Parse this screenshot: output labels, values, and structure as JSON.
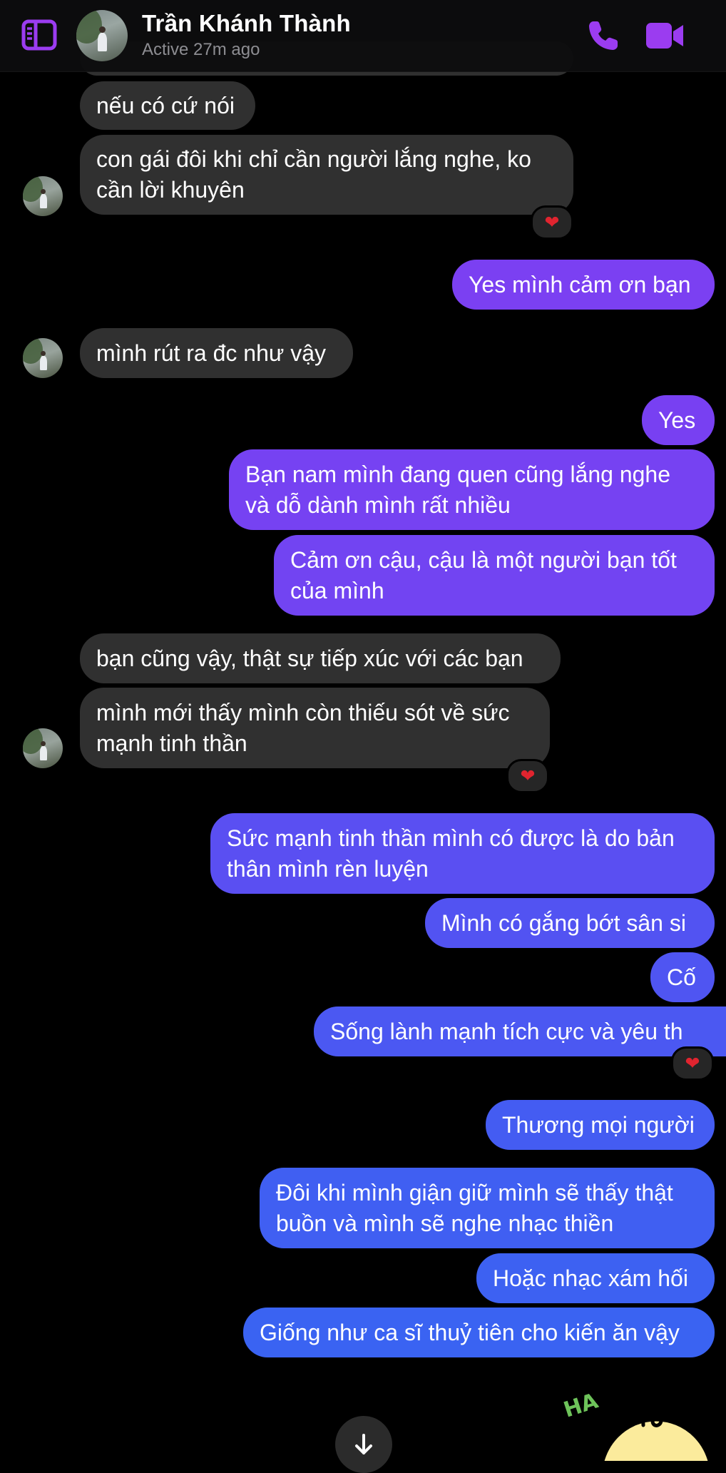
{
  "header": {
    "contact_name": "Trần Khánh Thành",
    "status": "Active 27m ago",
    "icons": [
      "sidebar-icon",
      "phone-icon",
      "video-icon"
    ],
    "accent_color": "#9b3cf0"
  },
  "messages": [
    {
      "from": "them",
      "text": "nếu có cứ nói"
    },
    {
      "from": "them",
      "lines": [
        "con gái đôi khi chỉ cần người lắng nghe, ko",
        "cần lời khuyên"
      ],
      "reaction": "❤"
    },
    {
      "from": "me",
      "text": "Yes mình cảm ơn bạn"
    },
    {
      "from": "them",
      "text": "mình rút ra đc như vậy"
    },
    {
      "from": "me",
      "text": "Yes"
    },
    {
      "from": "me",
      "lines": [
        "Bạn nam mình đang quen cũng lắng nghe",
        "và dỗ dành mình rất nhiều"
      ]
    },
    {
      "from": "me",
      "lines": [
        "Cảm ơn cậu, cậu là một người bạn tốt",
        "của mình"
      ]
    },
    {
      "from": "them",
      "text": "bạn cũng vậy, thật sự tiếp xúc với các bạn"
    },
    {
      "from": "them",
      "lines": [
        "mình mới thấy mình còn thiếu sót về sức",
        "mạnh tinh thần"
      ],
      "reaction": "❤"
    },
    {
      "from": "me",
      "lines": [
        "Sức mạnh tinh thần mình có được là do bản",
        "thân mình rèn luyện"
      ]
    },
    {
      "from": "me",
      "text": "Mình có gắng bớt sân si"
    },
    {
      "from": "me",
      "text": "Cố"
    },
    {
      "from": "me",
      "text": "Sống lành mạnh tích cực và yêu th",
      "reaction": "❤"
    },
    {
      "from": "me",
      "text": "Thương mọi người"
    },
    {
      "from": "me",
      "lines": [
        "Đôi khi mình giận giữ mình sẽ thấy thật",
        "buồn và mình sẽ nghe nhạc thiền"
      ]
    },
    {
      "from": "me",
      "text": "Hoặc nhạc xám hối"
    },
    {
      "from": "me",
      "text": "Giống như ca sĩ thuỷ tiên cho kiến ăn vậy"
    }
  ],
  "sticker": {
    "text": "HA"
  },
  "colors": {
    "incoming_bubble": "#303030",
    "outgoing_top": "#7a3ff0",
    "outgoing_bottom": "#3a60f0",
    "heart": "#e0242f"
  }
}
